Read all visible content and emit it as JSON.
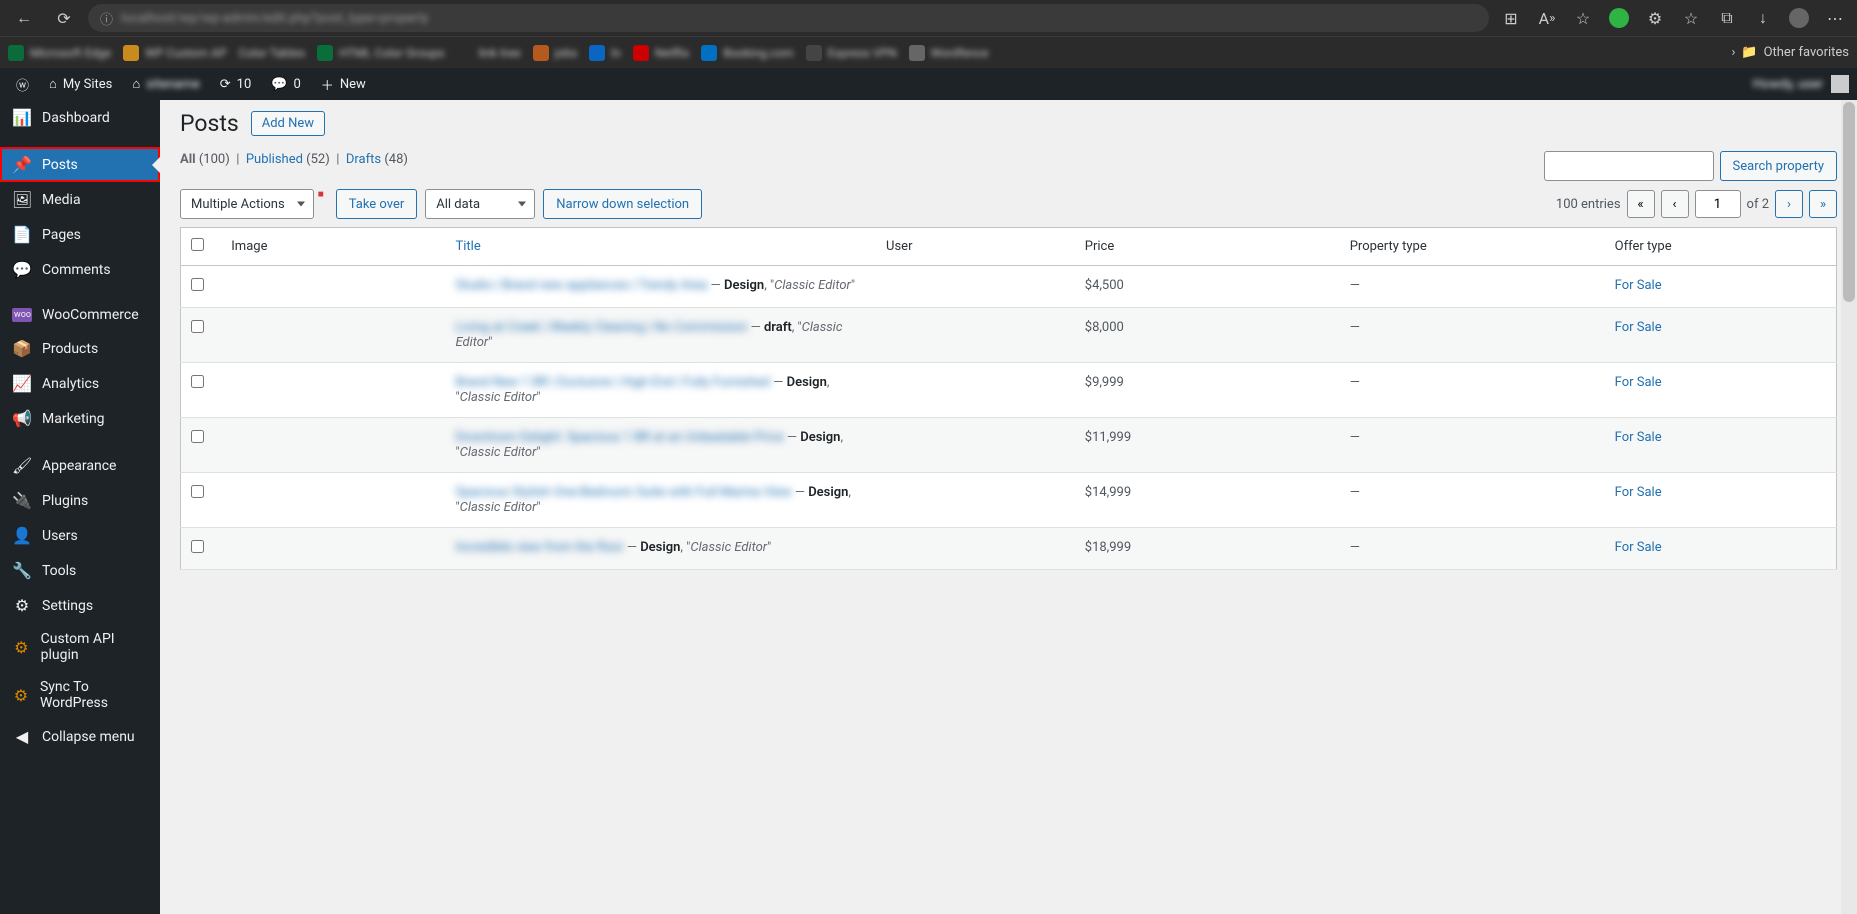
{
  "browser": {
    "other_favorites": "Other favorites"
  },
  "adminbar": {
    "my_sites": "My Sites",
    "updates": "10",
    "comments": "0",
    "new": "New"
  },
  "sidebar": {
    "dashboard": "Dashboard",
    "posts": "Posts",
    "media": "Media",
    "pages": "Pages",
    "comments": "Comments",
    "woocommerce": "WooCommerce",
    "products": "Products",
    "analytics": "Analytics",
    "marketing": "Marketing",
    "appearance": "Appearance",
    "plugins": "Plugins",
    "users": "Users",
    "tools": "Tools",
    "settings": "Settings",
    "custom_api": "Custom API plugin",
    "sync_wp": "Sync To WordPress",
    "collapse": "Collapse menu"
  },
  "page": {
    "title": "Posts",
    "add_new": "Add New"
  },
  "filters": {
    "all_label": "All",
    "all_count": "(100)",
    "published_label": "Published",
    "published_count": "(52)",
    "drafts_label": "Drafts",
    "drafts_count": "(48)"
  },
  "search": {
    "button": "Search property"
  },
  "actions": {
    "multiple": "Multiple Actions",
    "takeover": "Take over",
    "all_data": "All data",
    "narrow": "Narrow down selection"
  },
  "pagination": {
    "entries": "100 entries",
    "current": "1",
    "of": "of 2"
  },
  "columns": {
    "image": "Image",
    "title": "Title",
    "user": "User",
    "price": "Price",
    "property_type": "Property type",
    "offer_type": "Offer type"
  },
  "rows": [
    {
      "title": "Studio | Brand new appliances | Trendy Area",
      "status": "Design",
      "editor": "Classic Editor",
      "price": "$4,500",
      "ptype": "—",
      "otype": "For Sale"
    },
    {
      "title": "Living at Creek | Weekly Cleaning | No Commission",
      "status": "draft",
      "editor": "Classic Editor",
      "price": "$8,000",
      "ptype": "—",
      "otype": "For Sale"
    },
    {
      "title": "Brand New 1 BR | Exclusive | High End | Fully Furnished",
      "status": "Design",
      "editor": "Classic Editor",
      "price": "$9,999",
      "ptype": "—",
      "otype": "For Sale"
    },
    {
      "title": "Downtown Delight: Spacious 1 BR at an Unbeatable Price",
      "status": "Design",
      "editor": "Classic Editor",
      "price": "$11,999",
      "ptype": "—",
      "otype": "For Sale"
    },
    {
      "title": "Spacious Stylish One-Bedroom Suite with Full Marina View",
      "status": "Design",
      "editor": "Classic Editor",
      "price": "$14,999",
      "ptype": "—",
      "otype": "For Sale"
    },
    {
      "title": "Incredible view from the floor",
      "status": "Design",
      "editor": "Classic Editor",
      "price": "$18,999",
      "ptype": "—",
      "otype": "For Sale"
    }
  ]
}
